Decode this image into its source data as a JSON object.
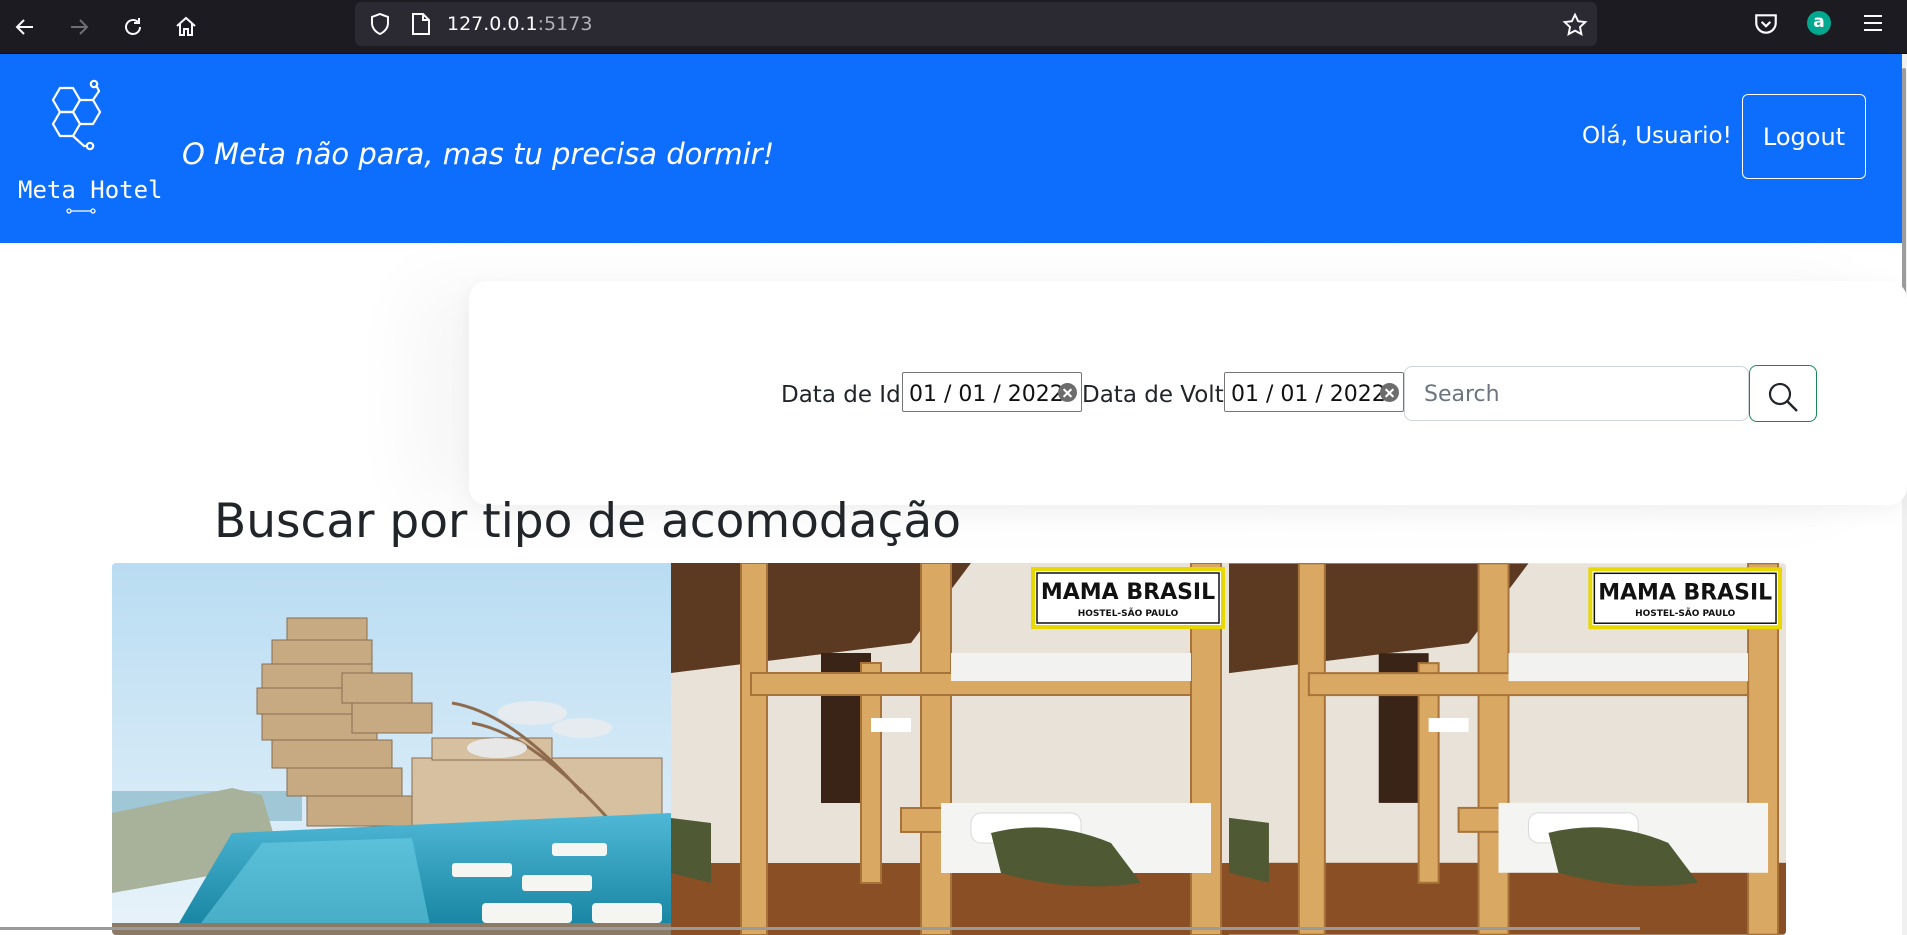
{
  "browser": {
    "url_host": "127.0.0.1",
    "url_port": ":5173"
  },
  "header": {
    "logo_text": "Meta Hotel",
    "tagline": "O Meta não para, mas tu precisa dormir!",
    "greeting": "Olá, Usuario!",
    "logout_label": "Logout",
    "brand_color": "#0d6efd"
  },
  "search": {
    "departure_label": "Data de Ida",
    "departure_value": "01 / 01 / 2022",
    "return_label": "Data de Volta",
    "return_value": "01 / 01 / 2022",
    "search_placeholder": "Search"
  },
  "section": {
    "title": "Buscar por tipo de acomodação"
  },
  "carousel": {
    "slides": [
      {
        "kind": "resort",
        "icon": "resort-photo"
      },
      {
        "kind": "hostel",
        "icon": "hostel-photo",
        "sign_title": "MAMA BRASIL",
        "sign_subtitle": "HOSTEL-SÃO PAULO"
      },
      {
        "kind": "hostel",
        "icon": "hostel-photo",
        "sign_title": "MAMA BRASIL",
        "sign_subtitle": "HOSTEL-SÃO PAULO"
      }
    ]
  }
}
